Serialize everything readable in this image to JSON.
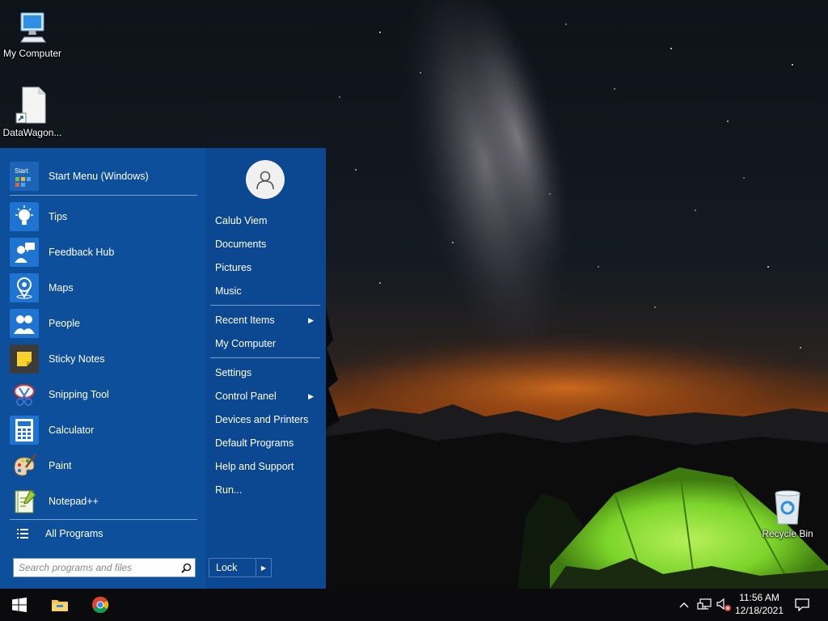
{
  "desktop": {
    "icons": [
      {
        "label": "My Computer",
        "icon": "computer-icon"
      },
      {
        "label": "DataWagon...",
        "icon": "document-shortcut-icon"
      },
      {
        "label": "Recycle Bin",
        "icon": "recycle-bin-icon"
      }
    ]
  },
  "start_menu": {
    "pinned": {
      "label": "Start Menu (Windows)",
      "icon": "start-menu-icon"
    },
    "apps": [
      {
        "label": "Tips",
        "icon": "lightbulb-icon"
      },
      {
        "label": "Feedback Hub",
        "icon": "feedback-icon"
      },
      {
        "label": "Maps",
        "icon": "map-pin-icon"
      },
      {
        "label": "People",
        "icon": "people-icon"
      },
      {
        "label": "Sticky Notes",
        "icon": "sticky-note-icon"
      },
      {
        "label": "Snipping Tool",
        "icon": "scissors-icon"
      },
      {
        "label": "Calculator",
        "icon": "calculator-icon"
      },
      {
        "label": "Paint",
        "icon": "palette-icon"
      },
      {
        "label": "Notepad++",
        "icon": "notepad-icon"
      }
    ],
    "all_programs": "All Programs",
    "search": {
      "placeholder": "Search programs and files"
    },
    "right": {
      "user": "Calub Viem",
      "documents": "Documents",
      "pictures": "Pictures",
      "music": "Music",
      "recent_items": "Recent Items",
      "my_computer": "My Computer",
      "settings": "Settings",
      "control_panel": "Control Panel",
      "devices_printers": "Devices and Printers",
      "default_programs": "Default Programs",
      "help_support": "Help and Support",
      "run": "Run...",
      "lock": "Lock"
    }
  },
  "taskbar": {
    "pinned": [
      {
        "icon": "windows-start-icon"
      },
      {
        "icon": "file-explorer-icon"
      },
      {
        "icon": "chrome-icon"
      }
    ],
    "tray": {
      "time": "11:56 AM",
      "date": "12/18/2021"
    }
  },
  "colors": {
    "menu_blue": "#0d4f9a",
    "taskbar": "#0b0b0d",
    "tent_green": "#7cd42a"
  }
}
